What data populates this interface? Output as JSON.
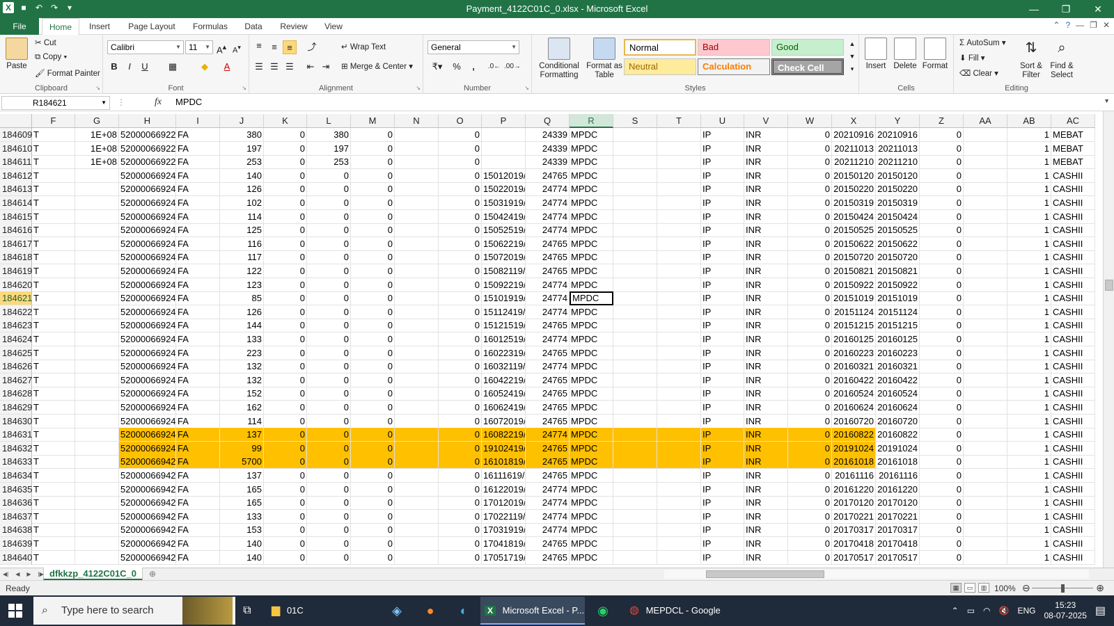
{
  "window": {
    "title": "Payment_4122C01C_0.xlsx - Microsoft Excel",
    "controls": [
      "—",
      "❐",
      "✕"
    ]
  },
  "qat": {
    "save": "💾",
    "undo": "↶",
    "redo": "↷",
    "more": "▾"
  },
  "ribbon_tabs": [
    {
      "label": "File"
    },
    {
      "label": "Home"
    },
    {
      "label": "Insert"
    },
    {
      "label": "Page Layout"
    },
    {
      "label": "Formulas"
    },
    {
      "label": "Data"
    },
    {
      "label": "Review"
    },
    {
      "label": "View"
    }
  ],
  "clipboard": {
    "paste": "Paste",
    "cut": "Cut",
    "copy": "Copy",
    "format_painter": "Format Painter",
    "label": "Clipboard"
  },
  "font": {
    "family": "Calibri",
    "size": "11",
    "label": "Font",
    "bold": "B",
    "italic": "I",
    "underline": "U"
  },
  "alignment": {
    "wrap_text": "Wrap Text",
    "merge_center": "Merge & Center",
    "label": "Alignment"
  },
  "number": {
    "format": "General",
    "label": "Number",
    "percent": "%",
    "comma": ","
  },
  "styles": {
    "conditional_formatting": "Conditional Formatting",
    "format_as_table": "Format as Table",
    "label": "Styles",
    "cells": [
      {
        "name": "Normal",
        "bg": "#ffffff",
        "fg": "#000000",
        "border": "#e6b84a"
      },
      {
        "name": "Bad",
        "bg": "#ffc7ce",
        "fg": "#9c0006",
        "border": "#ffc7ce"
      },
      {
        "name": "Good",
        "bg": "#c6efce",
        "fg": "#006100",
        "border": "#c6efce"
      },
      {
        "name": "Neutral",
        "bg": "#ffeb9c",
        "fg": "#9c6500",
        "border": "#ffeb9c"
      },
      {
        "name": "Calculation",
        "bg": "#f2f2f2",
        "fg": "#fa7d00",
        "border": "#7f7f7f"
      },
      {
        "name": "Check Cell",
        "bg": "#a5a5a5",
        "fg": "#ffffff",
        "border": "#3f3f3f"
      }
    ]
  },
  "cells_group": {
    "insert": "Insert",
    "delete": "Delete",
    "format": "Format",
    "label": "Cells"
  },
  "editing": {
    "autosum": "AutoSum",
    "fill": "Fill",
    "clear": "Clear",
    "sort_filter": "Sort & Filter",
    "find_select": "Find & Select",
    "label": "Editing"
  },
  "formula_bar": {
    "name_box": "R184621",
    "fx": "fx",
    "value": "MPDC"
  },
  "columns": [
    "F",
    "G",
    "H",
    "I",
    "J",
    "K",
    "L",
    "M",
    "N",
    "O",
    "P",
    "Q",
    "R",
    "S",
    "T",
    "U",
    "V",
    "W",
    "X",
    "Y",
    "Z",
    "AA",
    "AB",
    "AC"
  ],
  "active_column": "R",
  "active_row": "184621",
  "highlight_color": "#ffc000",
  "rows": [
    {
      "n": "184609",
      "F": "T",
      "G": "1E+08",
      "H": "52000066922",
      "I": "FA",
      "J": "380",
      "K": "0",
      "L": "380",
      "M": "0",
      "O": "0",
      "P": "",
      "Q": "24339",
      "R": "MPDC",
      "U": "IP",
      "V": "INR",
      "W": "0",
      "X": "20210916",
      "Y": "20210916",
      "Z": "0",
      "AB": "1",
      "AC": "MEBAT"
    },
    {
      "n": "184610",
      "F": "T",
      "G": "1E+08",
      "H": "52000066922",
      "I": "FA",
      "J": "197",
      "K": "0",
      "L": "197",
      "M": "0",
      "O": "0",
      "P": "",
      "Q": "24339",
      "R": "MPDC",
      "U": "IP",
      "V": "INR",
      "W": "0",
      "X": "20211013",
      "Y": "20211013",
      "Z": "0",
      "AB": "1",
      "AC": "MEBAT"
    },
    {
      "n": "184611",
      "F": "T",
      "G": "1E+08",
      "H": "52000066922",
      "I": "FA",
      "J": "253",
      "K": "0",
      "L": "253",
      "M": "0",
      "O": "0",
      "P": "",
      "Q": "24339",
      "R": "MPDC",
      "U": "IP",
      "V": "INR",
      "W": "0",
      "X": "20211210",
      "Y": "20211210",
      "Z": "0",
      "AB": "1",
      "AC": "MEBAT"
    },
    {
      "n": "184612",
      "F": "T",
      "G": "",
      "H": "52000066924",
      "I": "FA",
      "J": "140",
      "K": "0",
      "L": "0",
      "M": "0",
      "O": "0",
      "P": "15012019/",
      "Q": "24765",
      "R": "MPDC",
      "U": "IP",
      "V": "INR",
      "W": "0",
      "X": "20150120",
      "Y": "20150120",
      "Z": "0",
      "AB": "1",
      "AC": "CASHII"
    },
    {
      "n": "184613",
      "F": "T",
      "G": "",
      "H": "52000066924",
      "I": "FA",
      "J": "126",
      "K": "0",
      "L": "0",
      "M": "0",
      "O": "0",
      "P": "15022019/",
      "Q": "24774",
      "R": "MPDC",
      "U": "IP",
      "V": "INR",
      "W": "0",
      "X": "20150220",
      "Y": "20150220",
      "Z": "0",
      "AB": "1",
      "AC": "CASHII"
    },
    {
      "n": "184614",
      "F": "T",
      "G": "",
      "H": "52000066924",
      "I": "FA",
      "J": "102",
      "K": "0",
      "L": "0",
      "M": "0",
      "O": "0",
      "P": "15031919/",
      "Q": "24774",
      "R": "MPDC",
      "U": "IP",
      "V": "INR",
      "W": "0",
      "X": "20150319",
      "Y": "20150319",
      "Z": "0",
      "AB": "1",
      "AC": "CASHII"
    },
    {
      "n": "184615",
      "F": "T",
      "G": "",
      "H": "52000066924",
      "I": "FA",
      "J": "114",
      "K": "0",
      "L": "0",
      "M": "0",
      "O": "0",
      "P": "15042419/",
      "Q": "24774",
      "R": "MPDC",
      "U": "IP",
      "V": "INR",
      "W": "0",
      "X": "20150424",
      "Y": "20150424",
      "Z": "0",
      "AB": "1",
      "AC": "CASHII"
    },
    {
      "n": "184616",
      "F": "T",
      "G": "",
      "H": "52000066924",
      "I": "FA",
      "J": "125",
      "K": "0",
      "L": "0",
      "M": "0",
      "O": "0",
      "P": "15052519/",
      "Q": "24774",
      "R": "MPDC",
      "U": "IP",
      "V": "INR",
      "W": "0",
      "X": "20150525",
      "Y": "20150525",
      "Z": "0",
      "AB": "1",
      "AC": "CASHII"
    },
    {
      "n": "184617",
      "F": "T",
      "G": "",
      "H": "52000066924",
      "I": "FA",
      "J": "116",
      "K": "0",
      "L": "0",
      "M": "0",
      "O": "0",
      "P": "15062219/",
      "Q": "24765",
      "R": "MPDC",
      "U": "IP",
      "V": "INR",
      "W": "0",
      "X": "20150622",
      "Y": "20150622",
      "Z": "0",
      "AB": "1",
      "AC": "CASHII"
    },
    {
      "n": "184618",
      "F": "T",
      "G": "",
      "H": "52000066924",
      "I": "FA",
      "J": "117",
      "K": "0",
      "L": "0",
      "M": "0",
      "O": "0",
      "P": "15072019/",
      "Q": "24765",
      "R": "MPDC",
      "U": "IP",
      "V": "INR",
      "W": "0",
      "X": "20150720",
      "Y": "20150720",
      "Z": "0",
      "AB": "1",
      "AC": "CASHII"
    },
    {
      "n": "184619",
      "F": "T",
      "G": "",
      "H": "52000066924",
      "I": "FA",
      "J": "122",
      "K": "0",
      "L": "0",
      "M": "0",
      "O": "0",
      "P": "15082119/",
      "Q": "24765",
      "R": "MPDC",
      "U": "IP",
      "V": "INR",
      "W": "0",
      "X": "20150821",
      "Y": "20150821",
      "Z": "0",
      "AB": "1",
      "AC": "CASHII"
    },
    {
      "n": "184620",
      "F": "T",
      "G": "",
      "H": "52000066924",
      "I": "FA",
      "J": "123",
      "K": "0",
      "L": "0",
      "M": "0",
      "O": "0",
      "P": "15092219/",
      "Q": "24774",
      "R": "MPDC",
      "U": "IP",
      "V": "INR",
      "W": "0",
      "X": "20150922",
      "Y": "20150922",
      "Z": "0",
      "AB": "1",
      "AC": "CASHII"
    },
    {
      "n": "184621",
      "F": "T",
      "G": "",
      "H": "52000066924",
      "I": "FA",
      "J": "85",
      "K": "0",
      "L": "0",
      "M": "0",
      "O": "0",
      "P": "15101919/",
      "Q": "24774",
      "R": "MPDC",
      "U": "IP",
      "V": "INR",
      "W": "0",
      "X": "20151019",
      "Y": "20151019",
      "Z": "0",
      "AB": "1",
      "AC": "CASHII"
    },
    {
      "n": "184622",
      "F": "T",
      "G": "",
      "H": "52000066924",
      "I": "FA",
      "J": "126",
      "K": "0",
      "L": "0",
      "M": "0",
      "O": "0",
      "P": "15112419/",
      "Q": "24774",
      "R": "MPDC",
      "U": "IP",
      "V": "INR",
      "W": "0",
      "X": "20151124",
      "Y": "20151124",
      "Z": "0",
      "AB": "1",
      "AC": "CASHII"
    },
    {
      "n": "184623",
      "F": "T",
      "G": "",
      "H": "52000066924",
      "I": "FA",
      "J": "144",
      "K": "0",
      "L": "0",
      "M": "0",
      "O": "0",
      "P": "15121519/",
      "Q": "24765",
      "R": "MPDC",
      "U": "IP",
      "V": "INR",
      "W": "0",
      "X": "20151215",
      "Y": "20151215",
      "Z": "0",
      "AB": "1",
      "AC": "CASHII"
    },
    {
      "n": "184624",
      "F": "T",
      "G": "",
      "H": "52000066924",
      "I": "FA",
      "J": "133",
      "K": "0",
      "L": "0",
      "M": "0",
      "O": "0",
      "P": "16012519/",
      "Q": "24774",
      "R": "MPDC",
      "U": "IP",
      "V": "INR",
      "W": "0",
      "X": "20160125",
      "Y": "20160125",
      "Z": "0",
      "AB": "1",
      "AC": "CASHII"
    },
    {
      "n": "184625",
      "F": "T",
      "G": "",
      "H": "52000066924",
      "I": "FA",
      "J": "223",
      "K": "0",
      "L": "0",
      "M": "0",
      "O": "0",
      "P": "16022319/",
      "Q": "24765",
      "R": "MPDC",
      "U": "IP",
      "V": "INR",
      "W": "0",
      "X": "20160223",
      "Y": "20160223",
      "Z": "0",
      "AB": "1",
      "AC": "CASHII"
    },
    {
      "n": "184626",
      "F": "T",
      "G": "",
      "H": "52000066924",
      "I": "FA",
      "J": "132",
      "K": "0",
      "L": "0",
      "M": "0",
      "O": "0",
      "P": "16032119/",
      "Q": "24774",
      "R": "MPDC",
      "U": "IP",
      "V": "INR",
      "W": "0",
      "X": "20160321",
      "Y": "20160321",
      "Z": "0",
      "AB": "1",
      "AC": "CASHII"
    },
    {
      "n": "184627",
      "F": "T",
      "G": "",
      "H": "52000066924",
      "I": "FA",
      "J": "132",
      "K": "0",
      "L": "0",
      "M": "0",
      "O": "0",
      "P": "16042219/",
      "Q": "24765",
      "R": "MPDC",
      "U": "IP",
      "V": "INR",
      "W": "0",
      "X": "20160422",
      "Y": "20160422",
      "Z": "0",
      "AB": "1",
      "AC": "CASHII"
    },
    {
      "n": "184628",
      "F": "T",
      "G": "",
      "H": "52000066924",
      "I": "FA",
      "J": "152",
      "K": "0",
      "L": "0",
      "M": "0",
      "O": "0",
      "P": "16052419/",
      "Q": "24765",
      "R": "MPDC",
      "U": "IP",
      "V": "INR",
      "W": "0",
      "X": "20160524",
      "Y": "20160524",
      "Z": "0",
      "AB": "1",
      "AC": "CASHII"
    },
    {
      "n": "184629",
      "F": "T",
      "G": "",
      "H": "52000066924",
      "I": "FA",
      "J": "162",
      "K": "0",
      "L": "0",
      "M": "0",
      "O": "0",
      "P": "16062419/",
      "Q": "24765",
      "R": "MPDC",
      "U": "IP",
      "V": "INR",
      "W": "0",
      "X": "20160624",
      "Y": "20160624",
      "Z": "0",
      "AB": "1",
      "AC": "CASHII"
    },
    {
      "n": "184630",
      "F": "T",
      "G": "",
      "H": "52000066924",
      "I": "FA",
      "J": "114",
      "K": "0",
      "L": "0",
      "M": "0",
      "O": "0",
      "P": "16072019/",
      "Q": "24765",
      "R": "MPDC",
      "U": "IP",
      "V": "INR",
      "W": "0",
      "X": "20160720",
      "Y": "20160720",
      "Z": "0",
      "AB": "1",
      "AC": "CASHII"
    },
    {
      "n": "184631",
      "F": "T",
      "G": "",
      "H": "52000066924",
      "I": "FA",
      "J": "137",
      "K": "0",
      "L": "0",
      "M": "0",
      "O": "0",
      "P": "16082219/",
      "Q": "24774",
      "R": "MPDC",
      "U": "IP",
      "V": "INR",
      "W": "0",
      "X": "20160822",
      "Y": "20160822",
      "Z": "0",
      "AB": "1",
      "AC": "CASHII",
      "highlight": true
    },
    {
      "n": "184632",
      "F": "T",
      "G": "",
      "H": "52000066924",
      "I": "FA",
      "J": "99",
      "K": "0",
      "L": "0",
      "M": "0",
      "O": "0",
      "P": "19102419/",
      "Q": "24765",
      "R": "MPDC",
      "U": "IP",
      "V": "INR",
      "W": "0",
      "X": "20191024",
      "Y": "20191024",
      "Z": "0",
      "AB": "1",
      "AC": "CASHII",
      "highlight": true
    },
    {
      "n": "184633",
      "F": "T",
      "G": "",
      "H": "52000066942",
      "I": "FA",
      "J": "5700",
      "K": "0",
      "L": "0",
      "M": "0",
      "O": "0",
      "P": "16101819/",
      "Q": "24765",
      "R": "MPDC",
      "U": "IP",
      "V": "INR",
      "W": "0",
      "X": "20161018",
      "Y": "20161018",
      "Z": "0",
      "AB": "1",
      "AC": "CASHII",
      "highlight": true
    },
    {
      "n": "184634",
      "F": "T",
      "G": "",
      "H": "52000066942",
      "I": "FA",
      "J": "137",
      "K": "0",
      "L": "0",
      "M": "0",
      "O": "0",
      "P": "16111619/",
      "Q": "24765",
      "R": "MPDC",
      "U": "IP",
      "V": "INR",
      "W": "0",
      "X": "20161116",
      "Y": "20161116",
      "Z": "0",
      "AB": "1",
      "AC": "CASHII"
    },
    {
      "n": "184635",
      "F": "T",
      "G": "",
      "H": "52000066942",
      "I": "FA",
      "J": "165",
      "K": "0",
      "L": "0",
      "M": "0",
      "O": "0",
      "P": "16122019/",
      "Q": "24774",
      "R": "MPDC",
      "U": "IP",
      "V": "INR",
      "W": "0",
      "X": "20161220",
      "Y": "20161220",
      "Z": "0",
      "AB": "1",
      "AC": "CASHII"
    },
    {
      "n": "184636",
      "F": "T",
      "G": "",
      "H": "52000066942",
      "I": "FA",
      "J": "165",
      "K": "0",
      "L": "0",
      "M": "0",
      "O": "0",
      "P": "17012019/",
      "Q": "24774",
      "R": "MPDC",
      "U": "IP",
      "V": "INR",
      "W": "0",
      "X": "20170120",
      "Y": "20170120",
      "Z": "0",
      "AB": "1",
      "AC": "CASHII"
    },
    {
      "n": "184637",
      "F": "T",
      "G": "",
      "H": "52000066942",
      "I": "FA",
      "J": "133",
      "K": "0",
      "L": "0",
      "M": "0",
      "O": "0",
      "P": "17022119/",
      "Q": "24774",
      "R": "MPDC",
      "U": "IP",
      "V": "INR",
      "W": "0",
      "X": "20170221",
      "Y": "20170221",
      "Z": "0",
      "AB": "1",
      "AC": "CASHII"
    },
    {
      "n": "184638",
      "F": "T",
      "G": "",
      "H": "52000066942",
      "I": "FA",
      "J": "153",
      "K": "0",
      "L": "0",
      "M": "0",
      "O": "0",
      "P": "17031919/",
      "Q": "24774",
      "R": "MPDC",
      "U": "IP",
      "V": "INR",
      "W": "0",
      "X": "20170317",
      "Y": "20170317",
      "Z": "0",
      "AB": "1",
      "AC": "CASHII"
    },
    {
      "n": "184639",
      "F": "T",
      "G": "",
      "H": "52000066942",
      "I": "FA",
      "J": "140",
      "K": "0",
      "L": "0",
      "M": "0",
      "O": "0",
      "P": "17041819/",
      "Q": "24765",
      "R": "MPDC",
      "U": "IP",
      "V": "INR",
      "W": "0",
      "X": "20170418",
      "Y": "20170418",
      "Z": "0",
      "AB": "1",
      "AC": "CASHII"
    },
    {
      "n": "184640",
      "F": "T",
      "G": "",
      "H": "52000066942",
      "I": "FA",
      "J": "140",
      "K": "0",
      "L": "0",
      "M": "0",
      "O": "0",
      "P": "17051719/",
      "Q": "24765",
      "R": "MPDC",
      "U": "IP",
      "V": "INR",
      "W": "0",
      "X": "20170517",
      "Y": "20170517",
      "Z": "0",
      "AB": "1",
      "AC": "CASHII"
    }
  ],
  "sheet_tab": "dfkkzp_4122C01C_0",
  "status": {
    "ready": "Ready",
    "zoom": "100%",
    "zoom_level": 1.0
  },
  "taskbar": {
    "search_placeholder": "Type here to search",
    "items": [
      {
        "label": "01C",
        "icon": "folder-icon"
      },
      {
        "label": "Microsoft Excel - P...",
        "icon": "excel-icon",
        "active": true
      },
      {
        "label": "MEPDCL - Google ...",
        "icon": "chrome-icon"
      }
    ],
    "lang": "ENG",
    "time": "15:23",
    "date": "08-07-2025"
  }
}
